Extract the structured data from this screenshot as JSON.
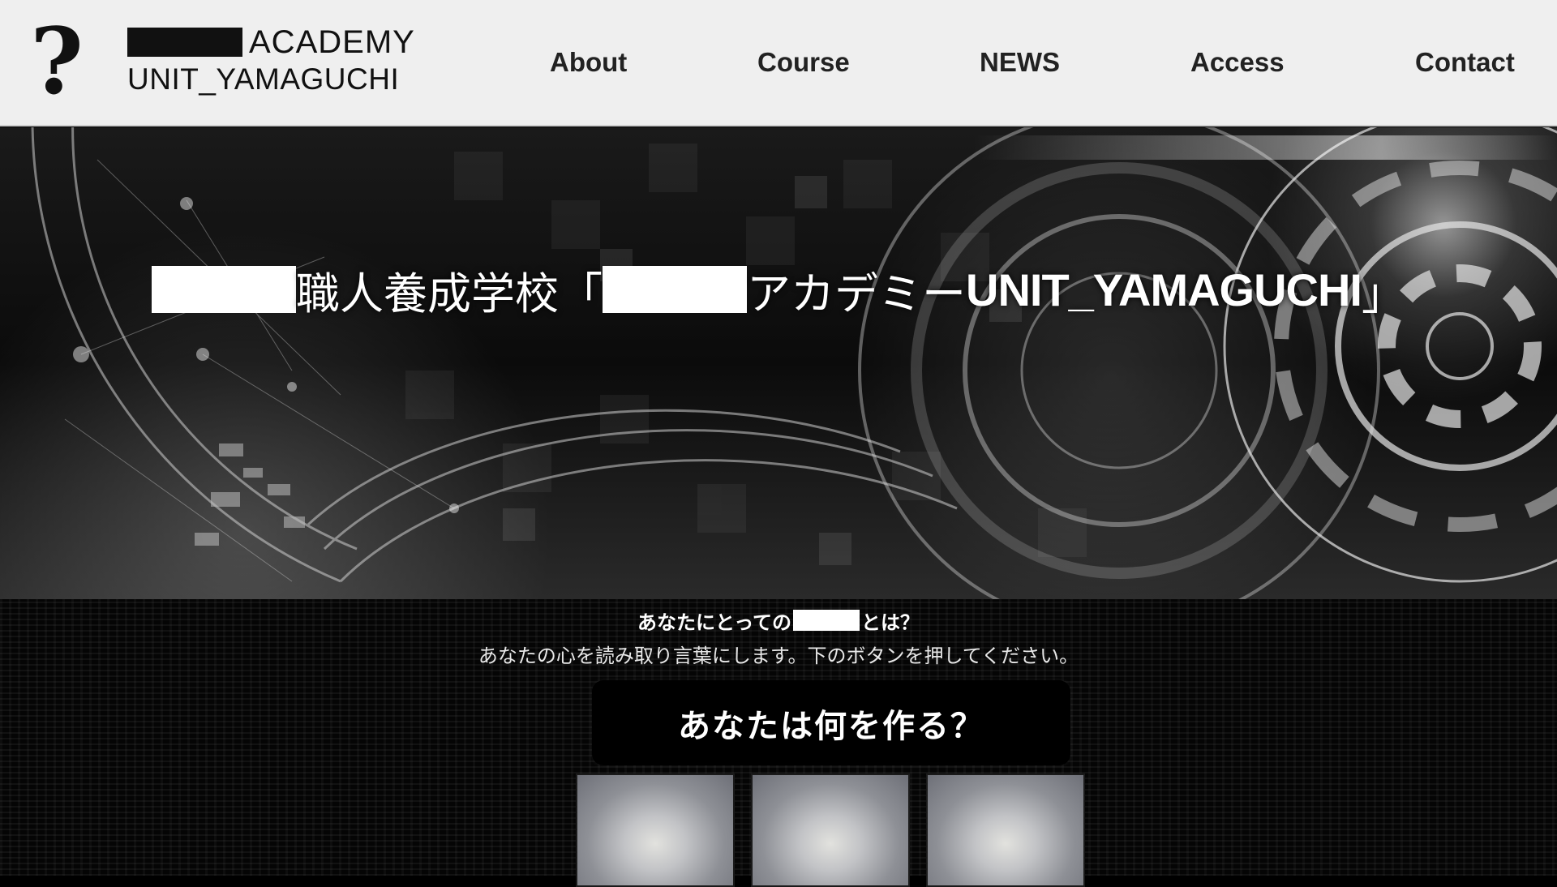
{
  "header": {
    "logo_icon": "question-mark-icon",
    "logo_glyph": "?",
    "logo_line1": "ACADEMY",
    "logo_line2": "UNIT_YAMAGUCHI",
    "nav": [
      {
        "label": "About"
      },
      {
        "label": "Course"
      },
      {
        "label": "NEWS"
      },
      {
        "label": "Access"
      },
      {
        "label": "Contact"
      }
    ]
  },
  "hero": {
    "title_part1": "職人養成学校「",
    "title_part2": "アカデミー",
    "title_part3": "UNIT_YAMAGUCHI",
    "title_part4": "」"
  },
  "section": {
    "heading_before": "あなたにとっての",
    "heading_after": "とは？",
    "subtitle": "あなたの心を読み取り言葉にします。下のボタンを押してください。",
    "question": "あなたは何を作る？"
  },
  "colors": {
    "header_bg": "#efefef",
    "text_dark": "#222222",
    "hero_text": "#ffffff",
    "page_bg": "#000000"
  }
}
